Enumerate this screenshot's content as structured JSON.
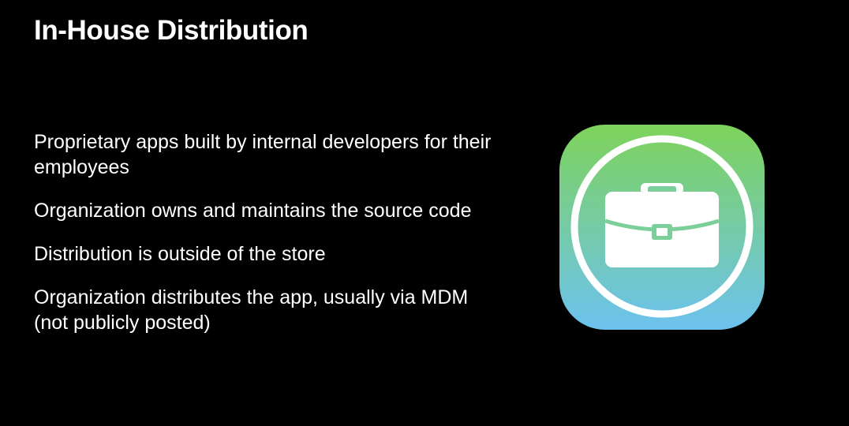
{
  "slide": {
    "title": "In-House Distribution",
    "bullets": [
      "Proprietary apps built by internal developers for their employees",
      "Organization owns and maintains the source code",
      "Distribution is outside of the store",
      "Organization distributes the app, usually via MDM (not publicly posted)"
    ]
  },
  "icon": {
    "name": "briefcase-icon",
    "gradient_top": "#7ed35b",
    "gradient_bottom": "#6cc2ef",
    "handle_color": "#7ccf9b"
  },
  "colors": {
    "background": "#000000",
    "text": "#ffffff"
  }
}
